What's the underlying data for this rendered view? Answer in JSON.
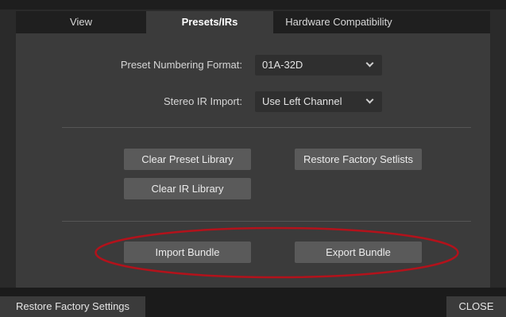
{
  "tabs": [
    {
      "label": "View",
      "active": false
    },
    {
      "label": "Presets/IRs",
      "active": true
    },
    {
      "label": "Hardware Compatibility",
      "active": false
    }
  ],
  "settings": {
    "preset_numbering": {
      "label": "Preset Numbering Format:",
      "value": "01A-32D"
    },
    "stereo_ir_import": {
      "label": "Stereo IR Import:",
      "value": "Use Left Channel"
    }
  },
  "actions": {
    "clear_preset_library": "Clear Preset Library",
    "restore_factory_setlists": "Restore Factory Setlists",
    "clear_ir_library": "Clear IR Library",
    "import_bundle": "Import Bundle",
    "export_bundle": "Export Bundle"
  },
  "footer": {
    "restore_factory_settings": "Restore Factory Settings",
    "close": "CLOSE"
  },
  "colors": {
    "highlight_ellipse": "#b3121b",
    "panel": "#3b3b3b",
    "button": "#5a5a5a"
  }
}
